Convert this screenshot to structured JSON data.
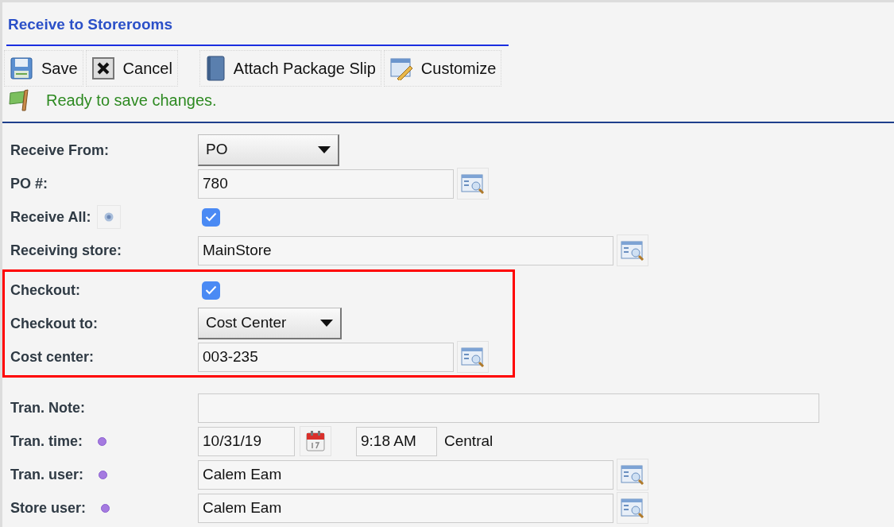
{
  "title": "Receive to Storerooms",
  "toolbar": [
    {
      "kind": "save",
      "label": "Save"
    },
    {
      "kind": "cancel",
      "label": "Cancel"
    },
    {
      "kind": "attach",
      "label": "Attach Package Slip"
    },
    {
      "kind": "customize",
      "label": "Customize"
    }
  ],
  "status": "Ready to save changes.",
  "sections": [
    {
      "highlighted": false,
      "fields": [
        {
          "kind": "select",
          "label": "Receive From:",
          "value": "PO"
        },
        {
          "kind": "lookup",
          "label": "PO #:",
          "value": "780"
        },
        {
          "kind": "checkbox",
          "label": "Receive All:",
          "help": true,
          "checked": true
        },
        {
          "kind": "lookup",
          "label": "Receiving store:",
          "value": "MainStore"
        }
      ]
    },
    {
      "highlighted": true,
      "fields": [
        {
          "kind": "checkbox",
          "label": "Checkout:",
          "checked": true
        },
        {
          "kind": "select",
          "label": "Checkout to:",
          "value": "Cost Center"
        },
        {
          "kind": "lookup",
          "label": "Cost center:",
          "value": "003-235"
        }
      ]
    },
    {
      "highlighted": false,
      "fields": [
        {
          "kind": "text",
          "label": "Tran. Note:"
        },
        {
          "kind": "datetime",
          "label": "Tran. time:",
          "required": true,
          "date": "10/31/19",
          "time": "9:18 AM",
          "zone": "Central"
        },
        {
          "kind": "lookup",
          "label": "Tran. user:",
          "required": true,
          "value": "Calem Eam"
        },
        {
          "kind": "lookup",
          "label": "Store user:",
          "required": true,
          "value": "Calem Eam"
        }
      ]
    }
  ]
}
